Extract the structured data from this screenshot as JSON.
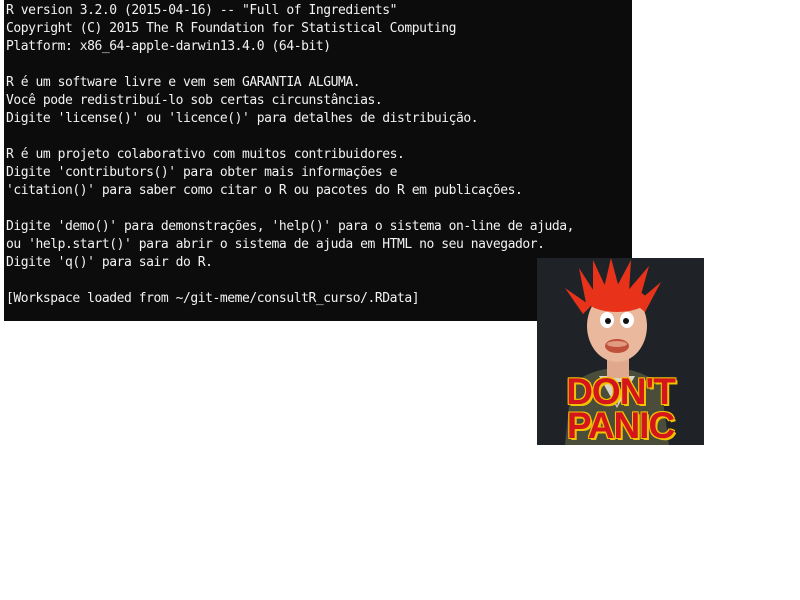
{
  "terminal": {
    "lines": [
      "R version 3.2.0 (2015-04-16) -- \"Full of Ingredients\"",
      "Copyright (C) 2015 The R Foundation for Statistical Computing",
      "Platform: x86_64-apple-darwin13.4.0 (64-bit)",
      "",
      "R é um software livre e vem sem GARANTIA ALGUMA.",
      "Você pode redistribuí-lo sob certas circunstâncias.",
      "Digite 'license()' ou 'licence()' para detalhes de distribuição.",
      "",
      "R é um projeto colaborativo com muitos contribuidores.",
      "Digite 'contributors()' para obter mais informações e",
      "'citation()' para saber como citar o R ou pacotes do R em publicações.",
      "",
      "Digite 'demo()' para demonstrações, 'help()' para o sistema on-line de ajuda,",
      "ou 'help.start()' para abrir o sistema de ajuda em HTML no seu navegador.",
      "Digite 'q()' para sair do R.",
      "",
      "[Workspace loaded from ~/git-meme/consultR_curso/.RData]"
    ]
  },
  "meme": {
    "line1": "DON'T",
    "line2": "PANIC",
    "text_color": "#d4151c",
    "outline_color": "#f2c200"
  }
}
